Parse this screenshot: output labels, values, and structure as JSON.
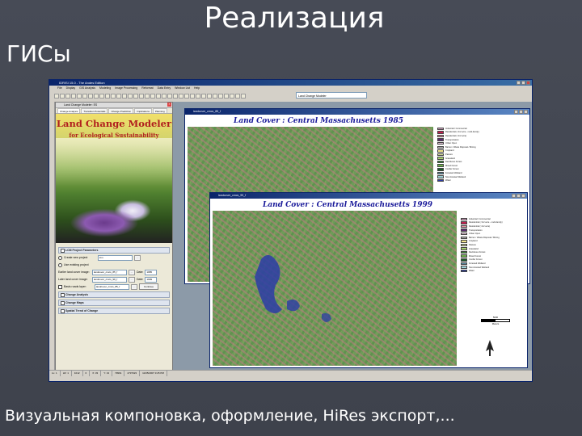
{
  "slide": {
    "title": "Реализация",
    "subtitle": "ГИСы",
    "caption": "Визуальная компоновка, оформление, HiRes экспорт,..."
  },
  "app": {
    "title": "IDRISI 15.0 - The Andes Edition",
    "menu": [
      "File",
      "Display",
      "GIS Analysis",
      "Modeling",
      "Image Processing",
      "Reformat",
      "Data Entry",
      "Window List",
      "Help"
    ],
    "toolbar_combo_value": "Land Change Modeler",
    "statusbar": [
      "LL: 1",
      "LR: 1",
      "1012",
      "0",
      "X: 33",
      "Y: 13",
      "79961",
      "4737023",
      "11/05/2007 3:25 PM"
    ]
  },
  "lcm": {
    "window_title": "Land Change Modeler: ES",
    "tabs": [
      "Change Analysis",
      "Transition Potentials",
      "Change Prediction",
      "Implications",
      "Planning"
    ],
    "banner_title": "Land Change Modeler",
    "banner_subtitle": "for Ecological Sustainability",
    "section_parameters": "LCM Project Parameters",
    "option_new": "Create new project",
    "option_existing": "Use existing project",
    "new_project_value": "lcm",
    "earlier_label": "Earlier land cover image:",
    "earlier_value": "landcover_cmcs_85_f",
    "earlier_date_label": "Date:",
    "earlier_date": "1985",
    "later_label": "Later land cover image:",
    "later_value": "landcover_cmcs_99_f",
    "later_date_label": "Date:",
    "later_date": "1999",
    "basis_label": "Basis roads layer:",
    "basis_value": "landcover_cmcs_85_f",
    "continue_label": "Continue",
    "section_change_analysis": "Change Analysis",
    "section_change_maps": "Change Maps",
    "section_spatial": "Spatial Trend of Change"
  },
  "map1985": {
    "window_title": "landcover_cmcs_85_f",
    "heading": "Land Cover : Central Massachusetts 1985"
  },
  "map1999": {
    "window_title": "landcover_cmcs_99_f",
    "heading": "Land Cover : Central Massachusetts 1999"
  },
  "legend": {
    "items": [
      {
        "label": "Industrial / Commercial",
        "color": "#d8a3c3"
      },
      {
        "label": "Residential (<1/2 acre - multi-family)",
        "color": "#c21f4f"
      },
      {
        "label": "Residential (>1/2 acre)",
        "color": "#e98fa1"
      },
      {
        "label": "Transportation",
        "color": "#5a2a6e"
      },
      {
        "label": "Urban Open",
        "color": "#e8c6d8"
      },
      {
        "label": "Barren / Waste Disposal / Mining",
        "color": "#b6b6b6"
      },
      {
        "label": "Cropland",
        "color": "#f2e48c"
      },
      {
        "label": "Pasture",
        "color": "#d9e39a"
      },
      {
        "label": "Grassland",
        "color": "#a6cf6f"
      },
      {
        "label": "Deciduous Forest",
        "color": "#3f8f3a"
      },
      {
        "label": "Mixed Forest",
        "color": "#6dae4c"
      },
      {
        "label": "Conifer Forest",
        "color": "#1c5a2a"
      },
      {
        "label": "Forested Wetland",
        "color": "#5b8fa8"
      },
      {
        "label": "Non-forested Wetland",
        "color": "#9fd1d6"
      },
      {
        "label": "Water",
        "color": "#2c3ca6"
      }
    ],
    "scale_label": "5000",
    "scale_unit": "Meters"
  }
}
